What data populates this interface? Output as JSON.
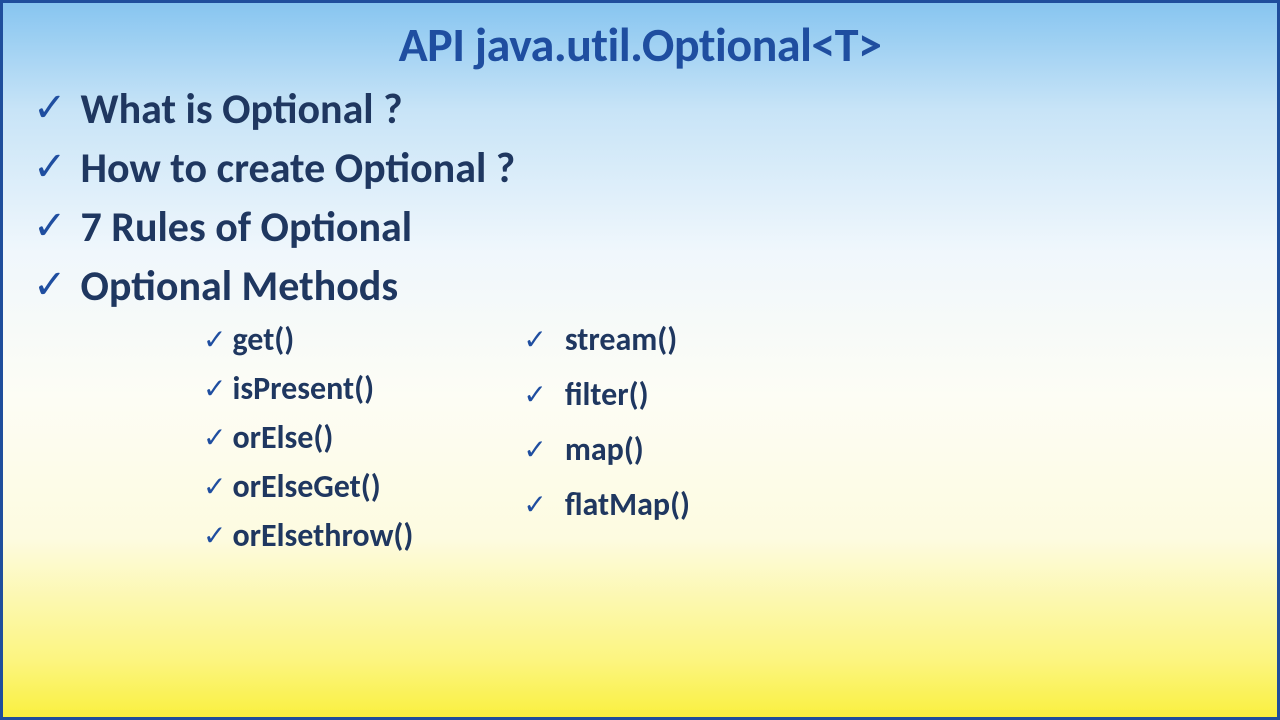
{
  "title": "API java.util.Optional<T>",
  "topics": [
    "What is Optional ?",
    "How to create Optional ?",
    "7 Rules of Optional",
    "Optional Methods"
  ],
  "methods_left": [
    "get()",
    "isPresent()",
    "orElse()",
    "orElseGet()",
    "orElsethrow()"
  ],
  "methods_right": [
    "stream()",
    "filter()",
    "map()",
    "flatMap()"
  ]
}
